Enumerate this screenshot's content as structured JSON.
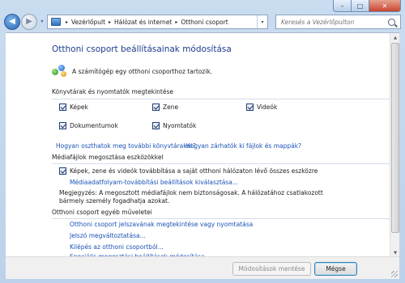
{
  "window": {
    "minimize_glyph": "–",
    "maximize_glyph": "□",
    "close_glyph": "✕"
  },
  "nav": {
    "breadcrumbs": [
      "Vezérlőpult",
      "Hálózat és internet",
      "Otthoni csoport"
    ],
    "crumb_separator": "▸",
    "search_placeholder": "Keresés a Vezérlőpulton",
    "back_glyph": "◀",
    "forward_glyph": "▶",
    "recent_glyph": "▾",
    "dropdown_glyph": "▾",
    "refresh_glyph": "↻"
  },
  "page": {
    "title": "Otthoni csoport beállításainak módosítása",
    "membership_text": "A számítógép egy otthoni csoporthoz tartozik."
  },
  "libraries": {
    "heading": "Könyvtárak és nyomtatók megtekintése",
    "items": [
      {
        "label": "Képek",
        "checked": true
      },
      {
        "label": "Zene",
        "checked": true
      },
      {
        "label": "Videók",
        "checked": true
      },
      {
        "label": "Dokumentumok",
        "checked": true
      },
      {
        "label": "Nyomtatók",
        "checked": true
      }
    ],
    "help_link_1": "Hogyan oszthatok meg további könyvtárakat?",
    "help_link_2": "Hogyan zárhatók ki fájlok és mappák?"
  },
  "media": {
    "heading": "Médiafájlok megosztása eszközökkel",
    "checkbox_label": "Képek, zene és videók továbbítása a saját otthoni hálózaton lévő összes eszközre",
    "checkbox_checked": true,
    "streaming_link": "Médiaadatfolyam-továbbítási beállítások kiválasztása...",
    "note": "Megjegyzés: A megosztott médiafájlok nem biztonságosak. A hálózatához csatlakozott bármely személy fogadhatja azokat."
  },
  "other_actions": {
    "heading": "Otthoni csoport egyéb műveletei",
    "links": [
      "Otthoni csoport jelszavának megtekintése vagy nyomtatása",
      "Jelszó megváltoztatása...",
      "Kilépés az otthoni csoportból...",
      "Speciális megosztási beállítások módosítása..."
    ]
  },
  "footer": {
    "save_label": "Módosítások mentése",
    "cancel_label": "Mégse"
  }
}
